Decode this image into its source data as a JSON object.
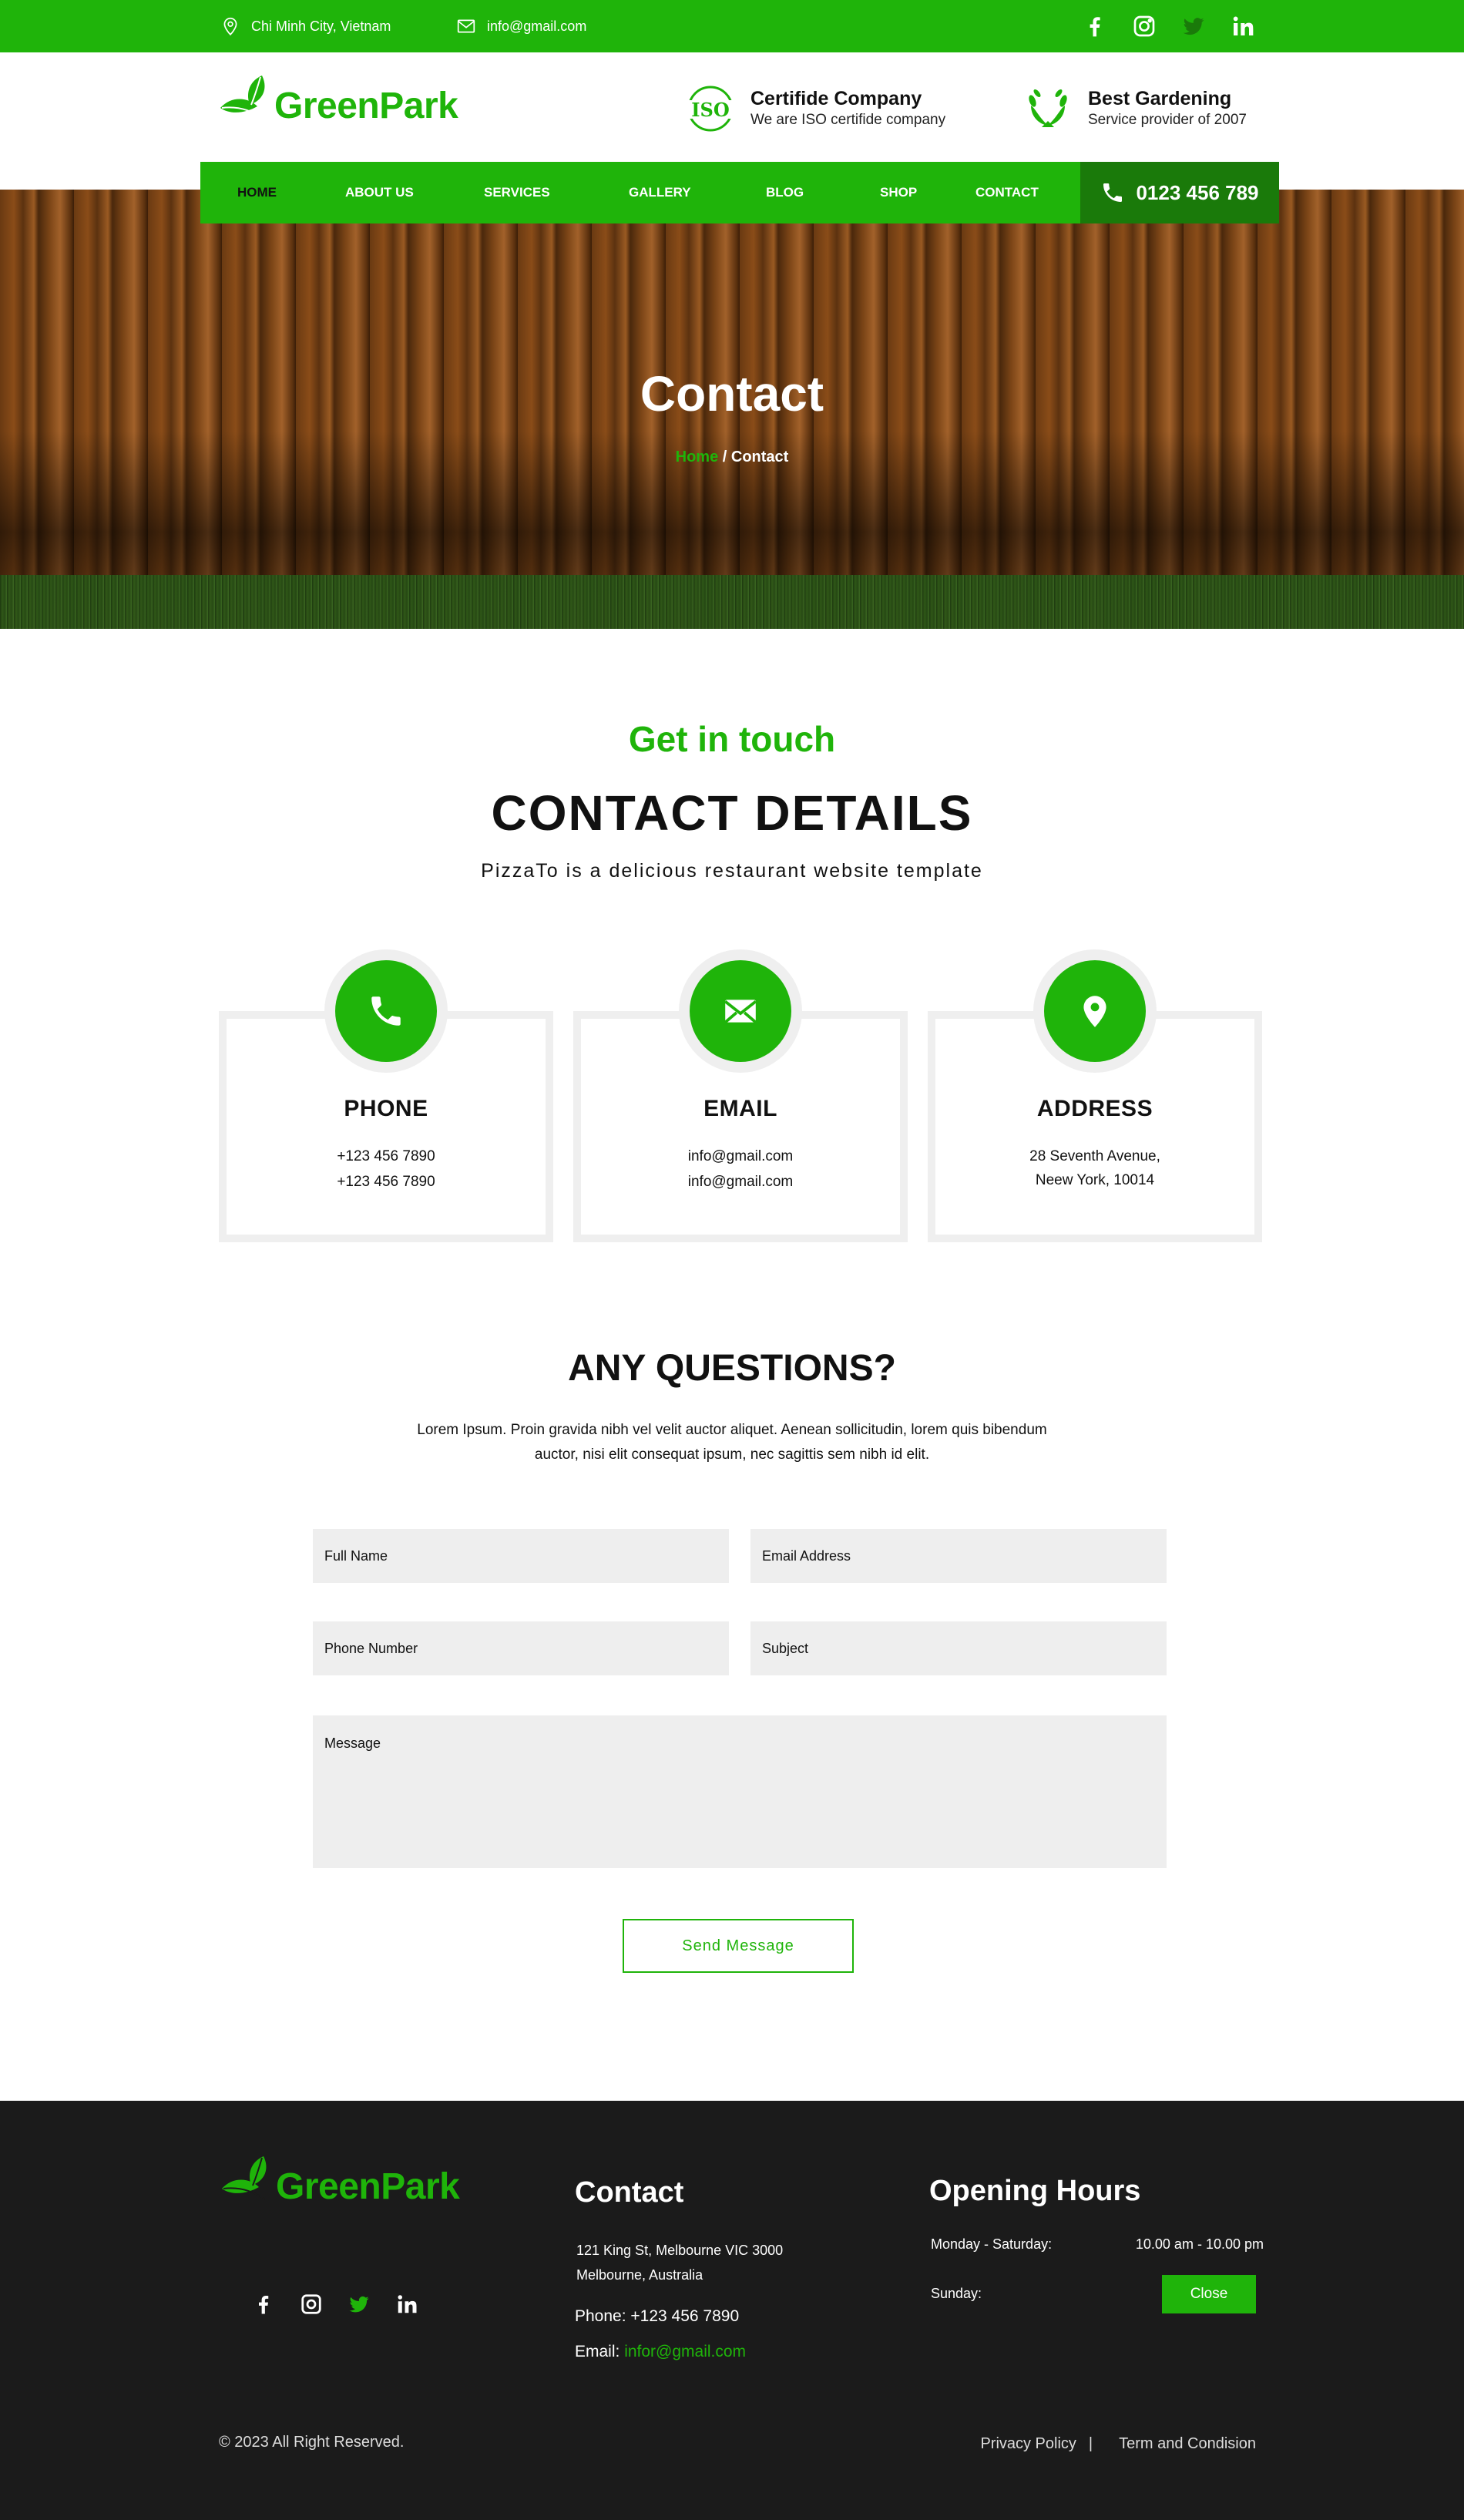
{
  "topbar": {
    "location": "Chi Minh City, Vietnam",
    "email": "info@gmail.com",
    "social": [
      "facebook-icon",
      "instagram-icon",
      "twitter-icon",
      "linkedin-icon"
    ]
  },
  "brand": {
    "name_green": "Green",
    "name_park": "Park",
    "color": "#1fb40a"
  },
  "badges": [
    {
      "icon": "iso-icon",
      "title": "Certifide Company",
      "sub": "We are ISO certifide company"
    },
    {
      "icon": "laurel-icon",
      "title": "Best Gardening",
      "sub": "Service provider of 2007"
    }
  ],
  "nav": {
    "items": [
      "HOME",
      "ABOUT US",
      "SERVICES",
      "GALLERY",
      "BLOG",
      "SHOP",
      "CONTACT"
    ],
    "active": "HOME",
    "phone": "0123 456 789"
  },
  "hero": {
    "title": "Contact",
    "crumb_home": "Home",
    "crumb_sep": " / ",
    "crumb_current": "Contact"
  },
  "contact": {
    "subtitle": "Get in touch",
    "title": "CONTACT DETAILS",
    "description": "PizzaTo is a delicious restaurant website template",
    "cards": [
      {
        "icon": "phone-icon",
        "title": "PHONE",
        "lines": [
          "+123 456 7890",
          "+123 456 7890"
        ]
      },
      {
        "icon": "envelope-icon",
        "title": "EMAIL",
        "lines": [
          "info@gmail.com",
          "info@gmail.com"
        ]
      },
      {
        "icon": "map-pin-icon",
        "title": "ADDRESS",
        "lines": [
          "28 Seventh Avenue,",
          "Neew York, 10014"
        ]
      }
    ]
  },
  "questions": {
    "title": "ANY QUESTIONS?",
    "description": "Lorem Ipsum. Proin gravida nibh vel velit auctor aliquet. Aenean sollicitudin, lorem quis bibendum auctor, nisi elit consequat ipsum, nec sagittis sem nibh id elit.",
    "form": {
      "full_name": "Full Name",
      "email": "Email Address",
      "phone": "Phone Number",
      "subject": "Subject",
      "message": "Message",
      "submit": "Send Message"
    }
  },
  "footer": {
    "contact_heading": "Contact",
    "address_line1": "121 King St, Melbourne VIC 3000",
    "address_line2": "Melbourne, Australia",
    "phone": "Phone: +123 456 7890",
    "email_label": "Email: ",
    "email_value": "infor@gmail.com",
    "hours_heading": "Opening Hours",
    "weekday_label": "Monday - Saturday:",
    "weekday_hours": "10.00 am - 10.00 pm",
    "sunday_label": "Sunday:",
    "sunday_status": "Close",
    "copyright": "© 2023 All Right Reserved.",
    "privacy": "Privacy Policy",
    "separator": "|",
    "terms": "Term and Condision"
  }
}
